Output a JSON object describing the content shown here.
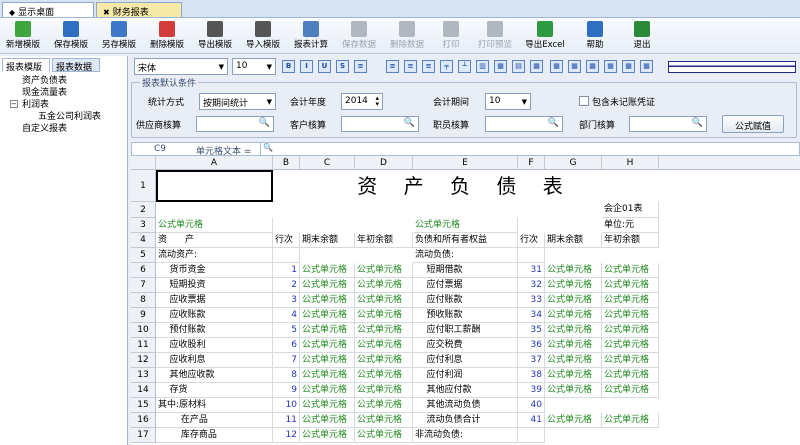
{
  "tabs": {
    "desktop": "显示桌面",
    "finance": "财务报表"
  },
  "toolbar": [
    {
      "label": "新增模版",
      "color": "#3da63d",
      "dis": false
    },
    {
      "label": "保存模版",
      "color": "#2f6fc2",
      "dis": false
    },
    {
      "label": "另存模版",
      "color": "#3f78c8",
      "dis": false
    },
    {
      "label": "删除模版",
      "color": "#d23c3c",
      "dis": false
    },
    {
      "label": "导出模版",
      "color": "#555",
      "dis": false
    },
    {
      "label": "导入模版",
      "color": "#555",
      "dis": false
    },
    {
      "label": "报表计算",
      "color": "#4f7fbf",
      "dis": false
    },
    {
      "label": "保存数据",
      "color": "#b0b7c0",
      "dis": true
    },
    {
      "label": "删除数据",
      "color": "#b0b7c0",
      "dis": true
    },
    {
      "label": "打印",
      "color": "#b0b7c0",
      "dis": true
    },
    {
      "label": "打印预览",
      "color": "#b0b7c0",
      "dis": true
    },
    {
      "label": "导出Excel",
      "color": "#2e9a42",
      "dis": false
    },
    {
      "label": "帮助",
      "color": "#2f6fc2",
      "dis": false
    },
    {
      "label": "退出",
      "color": "#2b8a3a",
      "dis": false
    }
  ],
  "format": {
    "font": "宋体",
    "size": "10"
  },
  "left": {
    "tabs": [
      "报表模版",
      "报表数据"
    ],
    "tree": [
      "资产负债表",
      "现金流量表",
      "利润表",
      "五金公司利润表",
      "自定义报表"
    ]
  },
  "conditions": {
    "legend": "报表默认条件",
    "stat_label": "统计方式",
    "stat_value": "按期间统计",
    "year_label": "会计年度",
    "year_value": "2014",
    "period_label": "会计期间",
    "period_value": "10",
    "include_label": "包含未记账凭证",
    "supplier_label": "供应商核算",
    "customer_label": "客户核算",
    "staff_label": "职员核算",
    "dept_label": "部门核算",
    "formula_btn": "公式赋值"
  },
  "cellbar": {
    "ref": "C9",
    "label": "单元格文本 ="
  },
  "columns": [
    "A",
    "B",
    "C",
    "D",
    "E",
    "F",
    "G",
    "H"
  ],
  "sheet": {
    "title": "资 产 负 债 表",
    "code": "会企01表",
    "unit": "单位:元",
    "formula": "公式单元格",
    "headers": [
      "资　　产",
      "行次",
      "期末余额",
      "年初余额",
      "负债和所有者权益",
      "行次",
      "期末余额",
      "年初余额"
    ],
    "rows": [
      {
        "a": "流动资产:",
        "b": "",
        "e": "流动负债:",
        "f": "",
        "cd": false,
        "gh": false
      },
      {
        "a": "    货币资金",
        "b": "1",
        "e": "    短期借款",
        "f": "31",
        "cd": true,
        "gh": true
      },
      {
        "a": "    短期投资",
        "b": "2",
        "e": "    应付票据",
        "f": "32",
        "cd": true,
        "gh": true
      },
      {
        "a": "    应收票据",
        "b": "3",
        "e": "    应付账款",
        "f": "33",
        "cd": true,
        "gh": true
      },
      {
        "a": "    应收账款",
        "b": "4",
        "e": "    预收账款",
        "f": "34",
        "cd": true,
        "gh": true
      },
      {
        "a": "    预付账款",
        "b": "5",
        "e": "    应付职工薪酬",
        "f": "35",
        "cd": true,
        "gh": true
      },
      {
        "a": "    应收股利",
        "b": "6",
        "e": "    应交税费",
        "f": "36",
        "cd": true,
        "gh": true
      },
      {
        "a": "    应收利息",
        "b": "7",
        "e": "    应付利息",
        "f": "37",
        "cd": true,
        "gh": true
      },
      {
        "a": "    其他应收款",
        "b": "8",
        "e": "    应付利润",
        "f": "38",
        "cd": true,
        "gh": true
      },
      {
        "a": "    存货",
        "b": "9",
        "e": "    其他应付款",
        "f": "39",
        "cd": true,
        "gh": true
      },
      {
        "a": "其中:原材料",
        "b": "10",
        "e": "    其他流动负债",
        "f": "40",
        "cd": true,
        "gh": false
      },
      {
        "a": "        在产品",
        "b": "11",
        "e": "    流动负债合计",
        "f": "41",
        "cd": true,
        "gh": true
      },
      {
        "a": "        库存商品",
        "b": "12",
        "e": "非流动负债:",
        "f": "",
        "cd": true,
        "gh": false
      }
    ]
  }
}
